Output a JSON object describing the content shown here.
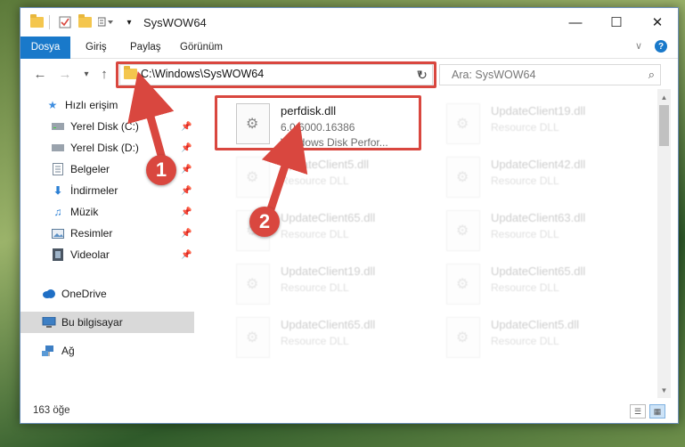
{
  "window": {
    "title": "SysWOW64"
  },
  "ribbon": {
    "tabs": [
      "Dosya",
      "Giriş",
      "Paylaş",
      "Görünüm"
    ]
  },
  "nav": {
    "address": "C:\\Windows\\SysWOW64",
    "search_placeholder": "Ara: SysWOW64"
  },
  "sidebar": {
    "items": [
      {
        "label": "Hızlı erişim",
        "icon": "star-icon"
      },
      {
        "label": "Yerel Disk (C:)",
        "icon": "drive-icon"
      },
      {
        "label": "Yerel Disk (D:)",
        "icon": "drive-icon"
      },
      {
        "label": "Belgeler",
        "icon": "documents-icon"
      },
      {
        "label": "İndirmeler",
        "icon": "download-icon"
      },
      {
        "label": "Müzik",
        "icon": "music-icon"
      },
      {
        "label": "Resimler",
        "icon": "pictures-icon"
      },
      {
        "label": "Videolar",
        "icon": "videos-icon"
      },
      {
        "label": "OneDrive",
        "icon": "cloud-icon"
      },
      {
        "label": "Bu bilgisayar",
        "icon": "computer-icon"
      },
      {
        "label": "Ağ",
        "icon": "network-icon"
      }
    ]
  },
  "files": [
    {
      "name": "perfdisk.dll",
      "line1": "6.0.6000.16386",
      "line2": "Windows Disk Perfor..."
    },
    {
      "name": "UpdateClient19.dll",
      "line1": "Resource DLL"
    },
    {
      "name": "UpdateClient5.dll",
      "line1": "Resource DLL"
    },
    {
      "name": "UpdateClient42.dll",
      "line1": "Resource DLL"
    },
    {
      "name": "UpdateClient65.dll",
      "line1": "Resource DLL"
    },
    {
      "name": "UpdateClient63.dll",
      "line1": "Resource DLL"
    },
    {
      "name": "UpdateClient19.dll",
      "line1": "Resource DLL"
    },
    {
      "name": "UpdateClient65.dll",
      "line1": "Resource DLL"
    },
    {
      "name": "UpdateClient65.dll",
      "line1": "Resource DLL"
    },
    {
      "name": "UpdateClient5.dll",
      "line1": "Resource DLL"
    }
  ],
  "status": {
    "count": "163 öğe"
  },
  "annotations": {
    "step1": "1",
    "step2": "2",
    "color": "#d9473f"
  }
}
